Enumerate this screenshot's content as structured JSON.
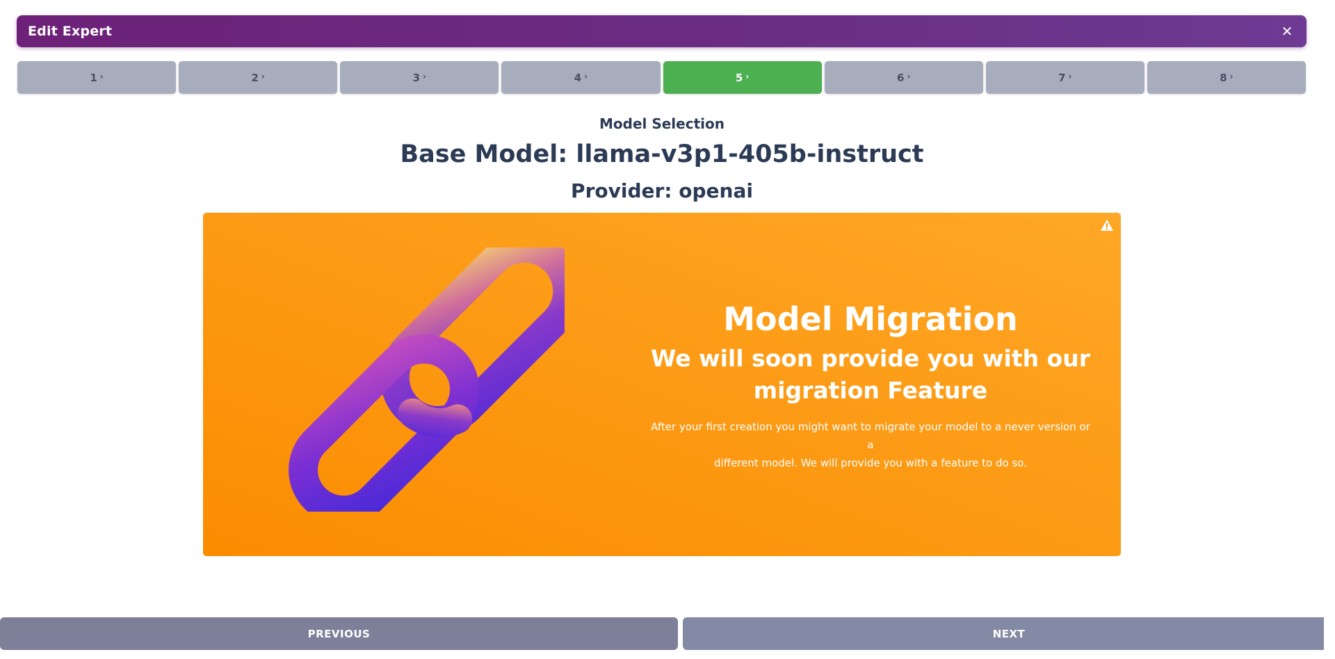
{
  "header": {
    "title": "Edit Expert",
    "close_label": "✕",
    "close_icon": "close-icon",
    "gradient": [
      "#6d2178",
      "#6e3a93"
    ]
  },
  "steps": [
    {
      "label": "1",
      "active": false
    },
    {
      "label": "2",
      "active": false
    },
    {
      "label": "3",
      "active": false
    },
    {
      "label": "4",
      "active": false
    },
    {
      "label": "5",
      "active": true
    },
    {
      "label": "6",
      "active": false
    },
    {
      "label": "7",
      "active": false
    },
    {
      "label": "8",
      "active": false
    }
  ],
  "step_chevron": "›",
  "step_colors": {
    "inactive": "#a8adbd",
    "active": "#4caf50"
  },
  "main": {
    "section_label": "Model Selection",
    "base_model": "Base Model: llama-v3p1-405b-instruct",
    "provider": "Provider: openai"
  },
  "banner": {
    "title": "Model Migration",
    "subtitle_line1": "We will soon provide you with our",
    "subtitle_line2": "migration Feature",
    "desc_line1": "After your first creation you might want to migrate your model to a never version or a",
    "desc_line2": "different model. We will provide you with a feature to do so.",
    "icon": "warning-icon",
    "illustration": "chain-link-image",
    "color": "#fb8c00"
  },
  "footer": {
    "previous_label": "PREVIOUS",
    "next_label": "NEXT"
  }
}
